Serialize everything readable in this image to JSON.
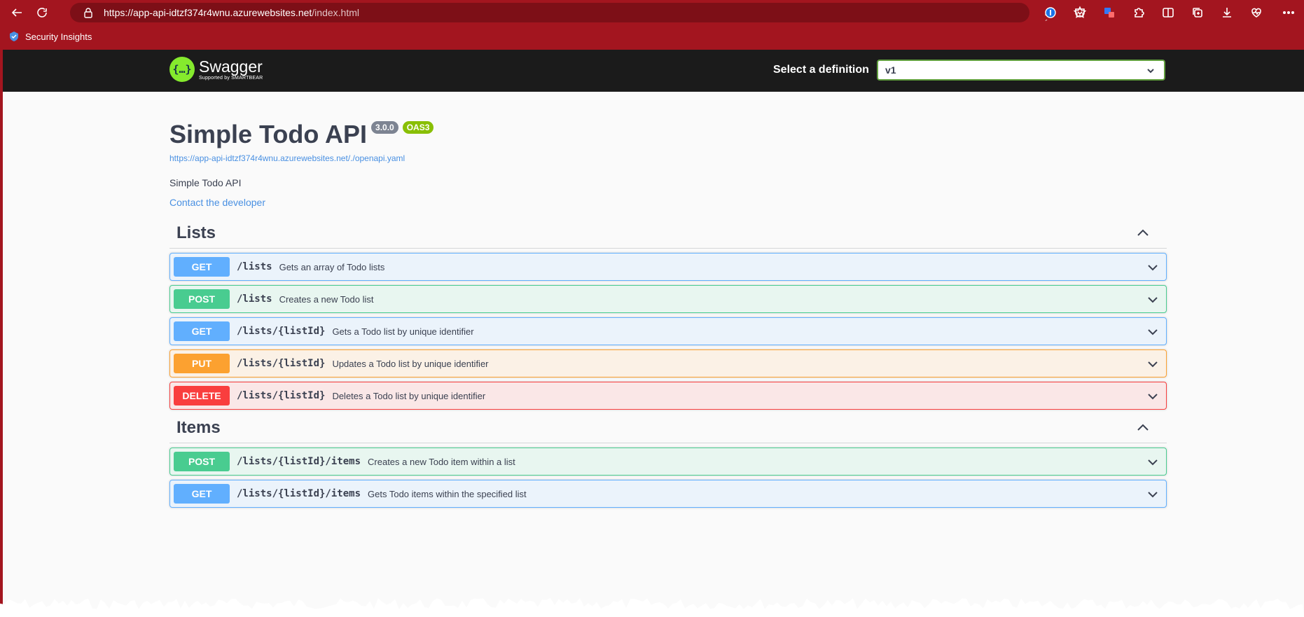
{
  "browser": {
    "url_main": "https://app-api-idtzf374r4wnu.azurewebsites.net",
    "url_path": "/index.html",
    "read_aloud": "A´",
    "favorites": [
      {
        "label": "Security Insights"
      }
    ]
  },
  "swagger": {
    "logo_title": "Swagger",
    "logo_subtitle": "Supported by SMARTBEAR",
    "definition_label": "Select a definition",
    "definition_value": "v1"
  },
  "info": {
    "title": "Simple Todo API",
    "version": "3.0.0",
    "oas": "OAS3",
    "spec_url": "https://app-api-idtzf374r4wnu.azurewebsites.net/./openapi.yaml",
    "description": "Simple Todo API",
    "contact": "Contact the developer"
  },
  "groups": [
    {
      "title": "Lists",
      "operations": [
        {
          "method": "GET",
          "path": "/lists",
          "summary": "Gets an array of Todo lists"
        },
        {
          "method": "POST",
          "path": "/lists",
          "summary": "Creates a new Todo list"
        },
        {
          "method": "GET",
          "path": "/lists/{listId}",
          "summary": "Gets a Todo list by unique identifier"
        },
        {
          "method": "PUT",
          "path": "/lists/{listId}",
          "summary": "Updates a Todo list by unique identifier"
        },
        {
          "method": "DELETE",
          "path": "/lists/{listId}",
          "summary": "Deletes a Todo list by unique identifier"
        }
      ]
    },
    {
      "title": "Items",
      "operations": [
        {
          "method": "POST",
          "path": "/lists/{listId}/items",
          "summary": "Creates a new Todo item within a list"
        },
        {
          "method": "GET",
          "path": "/lists/{listId}/items",
          "summary": "Gets Todo items within the specified list"
        }
      ]
    }
  ],
  "colors": {
    "browser_frame": "#a3151f",
    "get": "#61affe",
    "post": "#49cc90",
    "put": "#fca130",
    "delete": "#f93e3e",
    "swagger_green": "#85ea2d"
  }
}
